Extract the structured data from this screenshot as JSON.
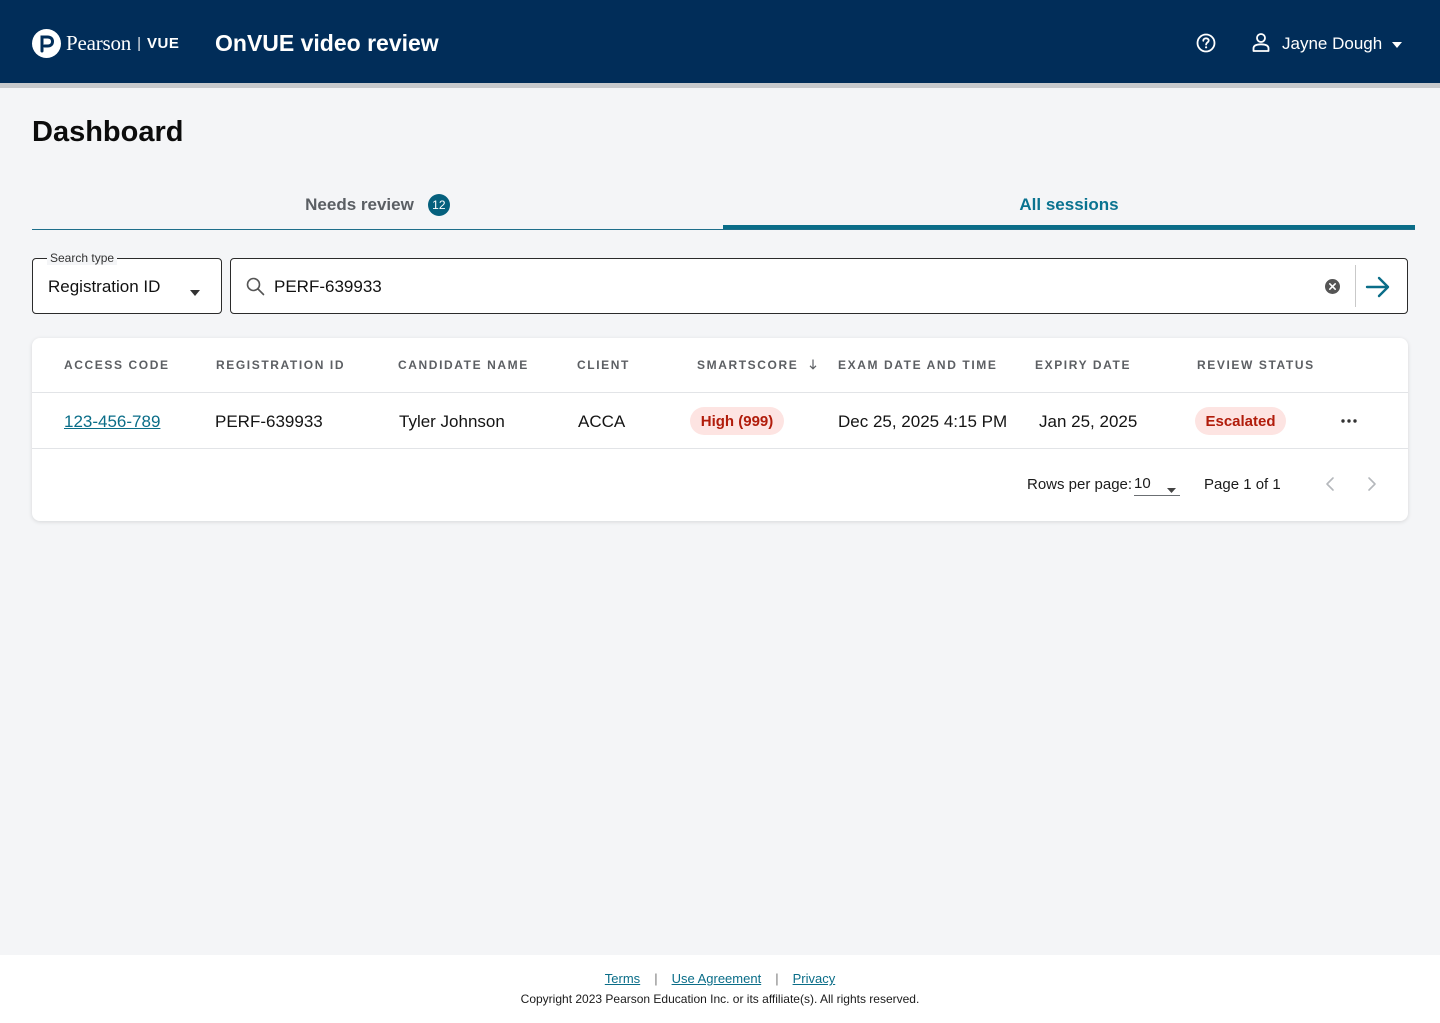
{
  "header": {
    "brand_name": "Pearson",
    "brand_separator": "|",
    "brand_product": "VUE",
    "app_title": "OnVUE video review",
    "user_name": "Jayne Dough",
    "icons": {
      "help": "help-circle-icon",
      "user": "user-icon",
      "caret": "caret-down-icon"
    }
  },
  "page": {
    "title": "Dashboard"
  },
  "tabs": [
    {
      "label": "Needs review",
      "badge": "12",
      "selected": false
    },
    {
      "label": "All sessions",
      "selected": true
    }
  ],
  "search": {
    "type_label": "Search type",
    "type_value": "Registration ID",
    "query": "PERF-639933",
    "icons": {
      "search": "search-icon",
      "clear": "clear-circle-icon",
      "submit": "arrow-right-icon"
    }
  },
  "table": {
    "columns": [
      "ACCESS CODE",
      "REGISTRATION ID",
      "CANDIDATE NAME",
      "CLIENT",
      "SMARTSCORE",
      "EXAM DATE AND TIME",
      "EXPIRY DATE",
      "REVIEW STATUS"
    ],
    "sort_column": "SMARTSCORE",
    "sort_direction": "descending",
    "rows": [
      {
        "access_code": "123-456-789",
        "registration_id": "PERF-639933",
        "candidate_name": "Tyler Johnson",
        "client": "ACCA",
        "smartscore": "High (999)",
        "exam_datetime": "Dec 25, 2025 4:15 PM",
        "expiry_date": "Jan 25, 2025",
        "review_status": "Escalated"
      }
    ]
  },
  "pagination": {
    "rows_per_page_label": "Rows per page:",
    "rows_per_page": "10",
    "page_info": "Page 1 of 1"
  },
  "footer": {
    "links": [
      "Terms",
      "Use Agreement",
      "Privacy"
    ],
    "separator": "|",
    "copyright": "Copyright 2023 Pearson Education Inc. or its affiliate(s). All rights reserved."
  },
  "colors": {
    "header_bg": "#012d59",
    "accent": "#0a6d88",
    "badge_bg": "#05607d",
    "pill_bg": "#fde4e2",
    "pill_text": "#b11c0b",
    "page_bg": "#f4f5f7"
  }
}
